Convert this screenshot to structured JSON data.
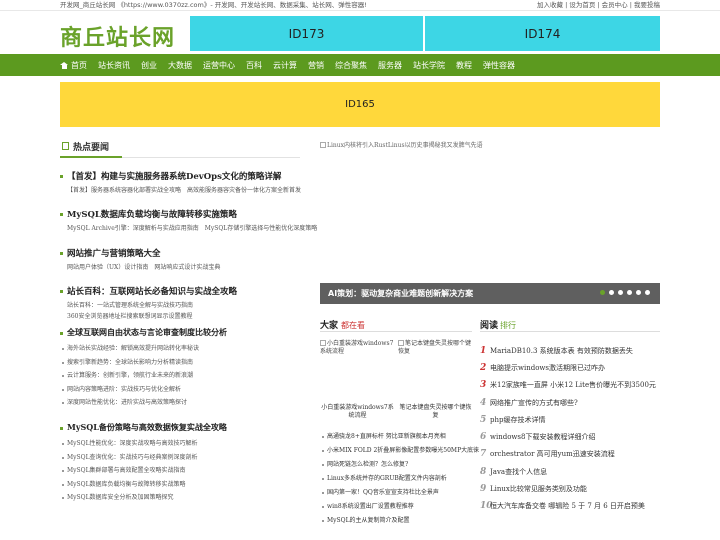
{
  "topbar": {
    "left": "开发网_商丘站长网 《https://www.0370zz.com》- 开发网、开发站长网、数据采集、站长网、弹性容器!",
    "right": "加入收藏 | 设为首页 | 会员中心 | 我要投稿"
  },
  "header": {
    "logo": "商丘站长网",
    "ad1": "ID173",
    "ad2": "ID174"
  },
  "nav": {
    "items": [
      "首页",
      "站长资讯",
      "创业",
      "大数据",
      "运营中心",
      "百科",
      "云计算",
      "营销",
      "综合聚焦",
      "服务器",
      "站长学院",
      "教程",
      "弹性容器"
    ]
  },
  "banner": {
    "label": "ID165"
  },
  "hot": {
    "title": "热点要闻",
    "news": [
      {
        "title": "【首发】构建与实施服务器系统DevOps文化的策略详解",
        "sub": "【首发】服务器系统容器化部署实战全攻略　高效能服务器容灾备份一体化方案全新首发"
      },
      {
        "title": "MySQL数据库负载均衡与故障转移实施策略",
        "sub": "MySQL Archive引擎：深度解析与实战应用指南　MySQL存储引擎选择与性能优化深度策略"
      },
      {
        "title": "网站推广与营销策略大全",
        "sub": "网站用户体验（UX）设计指南　网站响应式设计实战宝典"
      },
      {
        "title": "站长百科：互联网站长必备知识与实战全攻略",
        "sub": "站长百科：一站式管理系统全解与实战技巧指南",
        "sub2": "360安全浏览器地址栏搜索联想词显示设置教程"
      }
    ],
    "list1": {
      "title": "全球互联网自由状态与言论审查制度比较分析",
      "items": [
        "海外站长实战经验：解锁高效提升网站转化率秘诀",
        "搜索引擎新趋势：全球站长影响力分析精读指南",
        "云计算服务：创新引擎，领航行业未来的新浪潮",
        "网站内容策略进阶：实战技巧与优化全解析",
        "深度网站性能优化：进阶实战与高效策略探讨"
      ]
    },
    "list2": {
      "title": "MySQL备份策略与高效数据恢复实战全攻略",
      "items": [
        "MySQL性能优化：深度实战攻略与高效技巧解析",
        "MySQL查询优化：实战技巧与经典案例深度剖析",
        "MySQL集群部署与高效配置全攻略实战指南",
        "MySQL数据库负载均衡与故障转移实战策略",
        "MySQL数据库安全分析及加固策略探究"
      ]
    }
  },
  "slider": {
    "image_alt": "Linux内核将引入RustLinus以历史事揭秘我又发脾气先语",
    "caption": "AI策划：驱动复杂商业难题创新解决方案"
  },
  "pics": {
    "head_a": "大家",
    "head_b": "都在看",
    "items": [
      {
        "alt": "小白重装游戏windows7系统流程",
        "caption": "小白重装游戏windows7系统流程"
      },
      {
        "alt": "笔记本键盘失灵按哪个键恢复",
        "caption": "笔记本键盘失灵按哪个键恢复"
      }
    ],
    "list": [
      "高通骁龙8+直屏标杆 努比亚新旗舰本月亮相",
      "小米MIX FOLD 2折叠屏影像配置参数曝光50MP大底徕",
      "网站死链怎么检测？怎么修复?",
      "Linux多系统并存的GRUB配置文件内容剖析",
      "国内第一家！QQ音乐宣宣支持杜比全景声",
      "win8系统设置出厂设置教程推荐",
      "MySQL的主从复制简介及配置"
    ]
  },
  "rank": {
    "head_a": "阅读",
    "head_b": "排行",
    "items": [
      {
        "n": "1",
        "t": "MariaDB10.3 系统版本表 有效预防数据丢失"
      },
      {
        "n": "2",
        "t": "电脑提示windows激活期限已过咋办"
      },
      {
        "n": "3",
        "t": "米12家族唯一直屏 小米12 Lite售价曝光不到3500元"
      },
      {
        "n": "4",
        "t": "网络推广宣传的方式有哪些?"
      },
      {
        "n": "5",
        "t": "php缓存技术详情"
      },
      {
        "n": "6",
        "t": "windows8下载安装教程详细介绍"
      },
      {
        "n": "7",
        "t": "orchestrator 高可用yum迅速安装流程"
      },
      {
        "n": "8",
        "t": "Java查找个人信息"
      },
      {
        "n": "9",
        "t": "Linux比较常见服务类别及功能"
      },
      {
        "n": "10",
        "t": "恒大汽车库备交卷 哪辑险 5 于 7 月 6 日开启预美"
      }
    ]
  }
}
